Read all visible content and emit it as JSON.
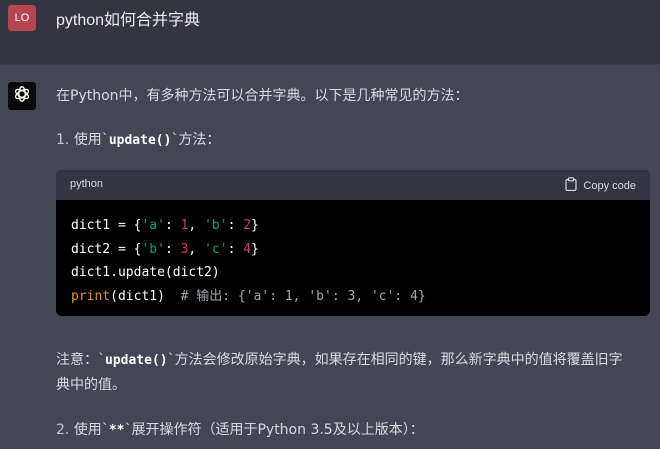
{
  "user": {
    "avatar_initials": "LO",
    "message": "python如何合并字典"
  },
  "assistant": {
    "avatar_icon": "openai-logo-icon",
    "intro": "在Python中，有多种方法可以合并字典。以下是几种常见的方法：",
    "item1": {
      "number": "1.",
      "prefix": "使用`",
      "code": "update()",
      "suffix": "`方法："
    },
    "code_block": {
      "language": "python",
      "copy_label": "Copy code",
      "line1": {
        "a": "dict1 = {",
        "s1": "'a'",
        "b": ": ",
        "n1": "1",
        "c": ", ",
        "s2": "'b'",
        "d": ": ",
        "n2": "2",
        "e": "}"
      },
      "line2": {
        "a": "dict2 = {",
        "s1": "'b'",
        "b": ": ",
        "n1": "3",
        "c": ", ",
        "s2": "'c'",
        "d": ": ",
        "n2": "4",
        "e": "}"
      },
      "line3": "dict1.update(dict2)",
      "line4": {
        "fn": "print",
        "args": "(dict1)  ",
        "comment": "# 输出: {'a': 1, 'b': 3, 'c': 4}"
      }
    },
    "note": {
      "prefix": "注意：`",
      "code": "update()",
      "line1_rest": "`方法会修改原始字典，如果存在相同的键，那么新字典中的值将覆盖旧字",
      "line2": "典中的值。"
    },
    "item2": {
      "number": "2.",
      "prefix": "使用`",
      "code": "**",
      "suffix": "`展开操作符（适用于Python 3.5及以上版本）："
    }
  },
  "colors": {
    "page_bg": "#444654",
    "user_row_bg": "#343541",
    "avatar_user_bg": "#b5454f",
    "string": "#00a67d",
    "number": "#df3079",
    "builtin": "#e9950c",
    "comment": "#a3a3ad"
  }
}
